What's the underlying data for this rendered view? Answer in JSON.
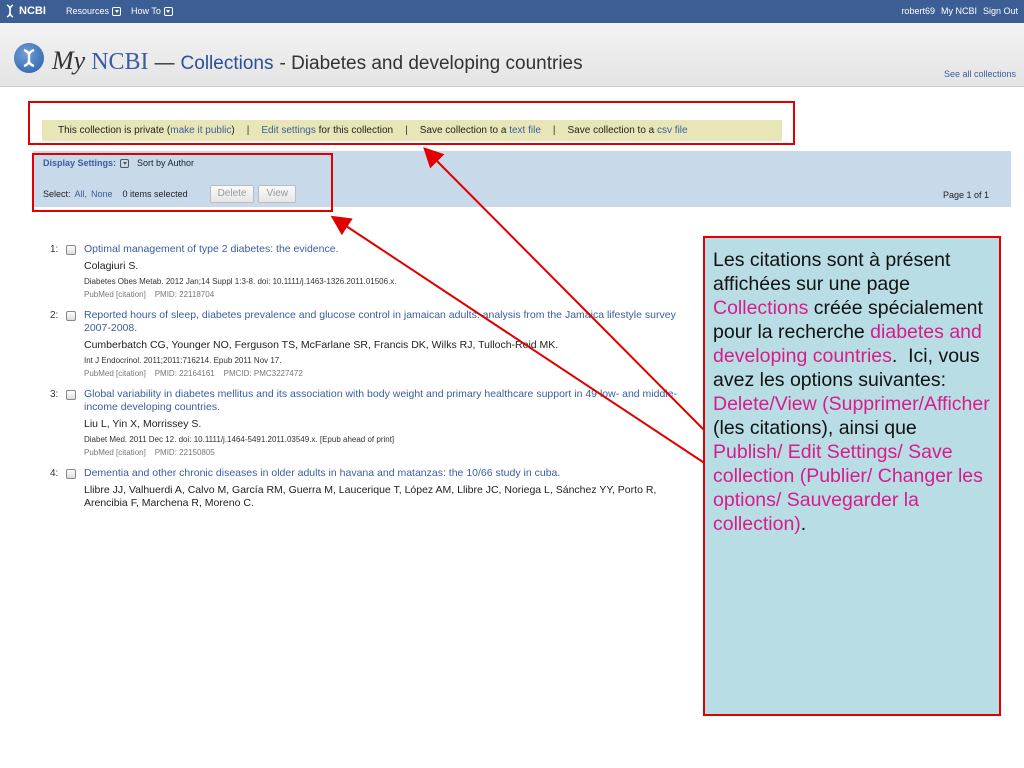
{
  "topbar": {
    "logo": "NCBI",
    "nav": [
      {
        "label": "Resources"
      },
      {
        "label": "How To"
      }
    ],
    "user": "robert69",
    "my_ncbi": "My NCBI",
    "sign_out": "Sign Out",
    "color": "#3d5e95"
  },
  "header": {
    "my": "My",
    "ncbi": "NCBI",
    "dash": "—",
    "collections": "Collections",
    "collection_name": "- Diabetes and developing countries",
    "see_all": "See all collections"
  },
  "toolbar": {
    "private_text": "This collection is private (",
    "make_public": "make it public",
    "private_close": ")",
    "sep": "|",
    "edit_settings": "Edit settings",
    "edit_suffix": " for this collection",
    "save_text_prefix": "Save collection to a ",
    "text_file": "text file",
    "save_csv_prefix": "Save collection to a ",
    "csv_file": "csv file",
    "bg_color": "#e8e6b6"
  },
  "display": {
    "settings_label": "Display Settings:",
    "sort": "Sort by Author",
    "select_label": "Select:",
    "all": "All,",
    "none": "None",
    "items_selected": "0 items selected",
    "delete": "Delete",
    "view": "View",
    "page": "Page 1 of 1"
  },
  "results": [
    {
      "num": "1:",
      "title": "Optimal management of type 2 diabetes: the evidence.",
      "authors": "Colagiuri S.",
      "source": "Diabetes Obes Metab. 2012 Jan;14 Suppl 1:3-8. doi: 10.1111/j.1463-1326.2011.01506.x.",
      "meta": "PubMed [citation]    PMID: 22118704"
    },
    {
      "num": "2:",
      "title": "Reported hours of sleep, diabetes prevalence and glucose control in jamaican adults: analysis from the Jamaica lifestyle survey 2007-2008.",
      "authors": "Cumberbatch CG, Younger NO, Ferguson TS, McFarlane SR, Francis DK, Wilks RJ, Tulloch-Reid MK.",
      "source": "Int J Endocrinol. 2011;2011:716214. Epub 2011 Nov 17.",
      "meta": "PubMed [citation]    PMID: 22164161    PMCID: PMC3227472"
    },
    {
      "num": "3:",
      "title": "Global variability in diabetes mellitus and its association with body weight and primary healthcare support in 49 low- and middle-income developing countries.",
      "authors": "Liu L, Yin X, Morrissey S.",
      "source": "Diabet Med. 2011 Dec 12. doi: 10.1111/j.1464-5491.2011.03549.x. [Epub ahead of print]",
      "meta": "PubMed [citation]    PMID: 22150805"
    },
    {
      "num": "4:",
      "title": "Dementia and other chronic diseases in older adults in havana and matanzas: the 10/66 study in cuba.",
      "authors": "Llibre JJ, Valhuerdi A, Calvo M, García RM, Guerra M, Laucerique T, López AM, Llibre JC, Noriega L, Sánchez YY, Porto R, Arencibia F, Marchena R, Moreno C.",
      "source": "",
      "meta": ""
    }
  ],
  "callout": {
    "p1": "Les citations sont à présent affichées sur une page ",
    "collections": "Collections",
    "p2": " créée spécialement pour la recherche ",
    "search": "diabetes and developing countries",
    "p3": ".  Ici, vous avez les options suivantes:  ",
    "delete_view": "Delete/View (Supprimer/Afficher",
    "p4": " (les citations), ainsi que ",
    "publish": "Publish/ Edit Settings/ Save collection (Publier/ Changer les options/ Sauvegarder la collection)",
    "p5": ".",
    "bg_color": "#b9dde4",
    "highlight_color": "#d81b8c",
    "border_color": "#e00000"
  }
}
